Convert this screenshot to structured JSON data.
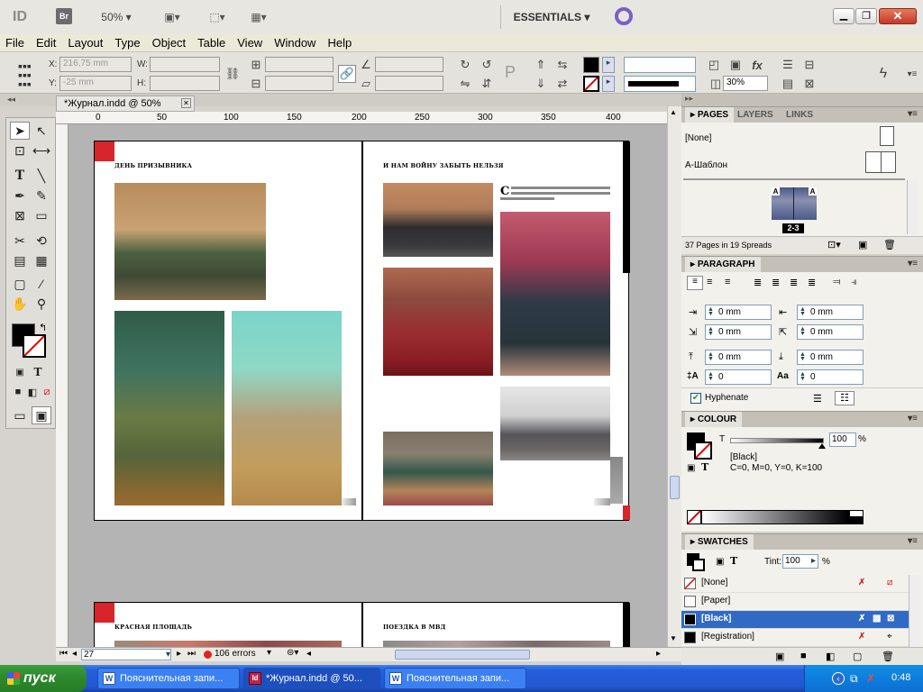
{
  "app": {
    "logo": "ID",
    "bridge": "Br",
    "zoom": "50%",
    "workspace": "ESSENTIALS"
  },
  "menu": [
    "File",
    "Edit",
    "Layout",
    "Type",
    "Object",
    "Table",
    "View",
    "Window",
    "Help"
  ],
  "control": {
    "x_label": "X:",
    "x_value": "216,75 mm",
    "y_label": "Y:",
    "y_value": "-25 mm",
    "w_label": "W:",
    "h_label": "H:",
    "opacity": "30%"
  },
  "document": {
    "tab_title": "*Журнал.indd @ 50%",
    "ruler_ticks": [
      "0",
      "50",
      "100",
      "150",
      "200",
      "250",
      "300",
      "350",
      "400"
    ],
    "pages": {
      "p2_heading": "ДЕНЬ ПРИЗЫВНИКА",
      "p3_heading": "И НАМ ВОЙНУ ЗАБЫТЬ НЕЛЬЗЯ",
      "p3_dropcap": "С",
      "p4_heading": "КРАСНАЯ ПЛОЩАДЬ",
      "p5_heading": "ПОЕЗДКА В МВД"
    }
  },
  "status": {
    "page": "27",
    "errors": "106 errors"
  },
  "panels": {
    "pages": {
      "tabs": [
        "PAGES",
        "LAYERS",
        "LINKS"
      ],
      "none_label": "[None]",
      "master_label": "A-Шаблон",
      "spread_label": "2-3",
      "master_letter": "A",
      "summary": "37 Pages in 19 Spreads"
    },
    "paragraph": {
      "title": "PARAGRAPH",
      "left_indent": "0 mm",
      "right_indent": "0 mm",
      "first_line": "0 mm",
      "last_line": "0 mm",
      "space_before": "0 mm",
      "space_after": "0 mm",
      "drop_lines": "0",
      "drop_chars": "0",
      "hyphenate": "Hyphenate"
    },
    "colour": {
      "title": "COLOUR",
      "tint_label": "T",
      "tint_value": "100",
      "percent": "%",
      "swatch_name": "[Black]",
      "cmyk": "C=0, M=0, Y=0, K=100"
    },
    "swatches": {
      "title": "SWATCHES",
      "tint_label": "Tint:",
      "tint_value": "100",
      "percent": "%",
      "items": [
        "[None]",
        "[Paper]",
        "[Black]",
        "[Registration]"
      ]
    }
  },
  "taskbar": {
    "start": "пуск",
    "buttons": [
      "Пояснительная запи...",
      "*Журнал.indd @ 50...",
      "Пояснительная запи..."
    ],
    "lang": "RU",
    "time": "0:48"
  },
  "colors": {
    "accent_red": "#d8242b",
    "selection": "#316ac5"
  }
}
